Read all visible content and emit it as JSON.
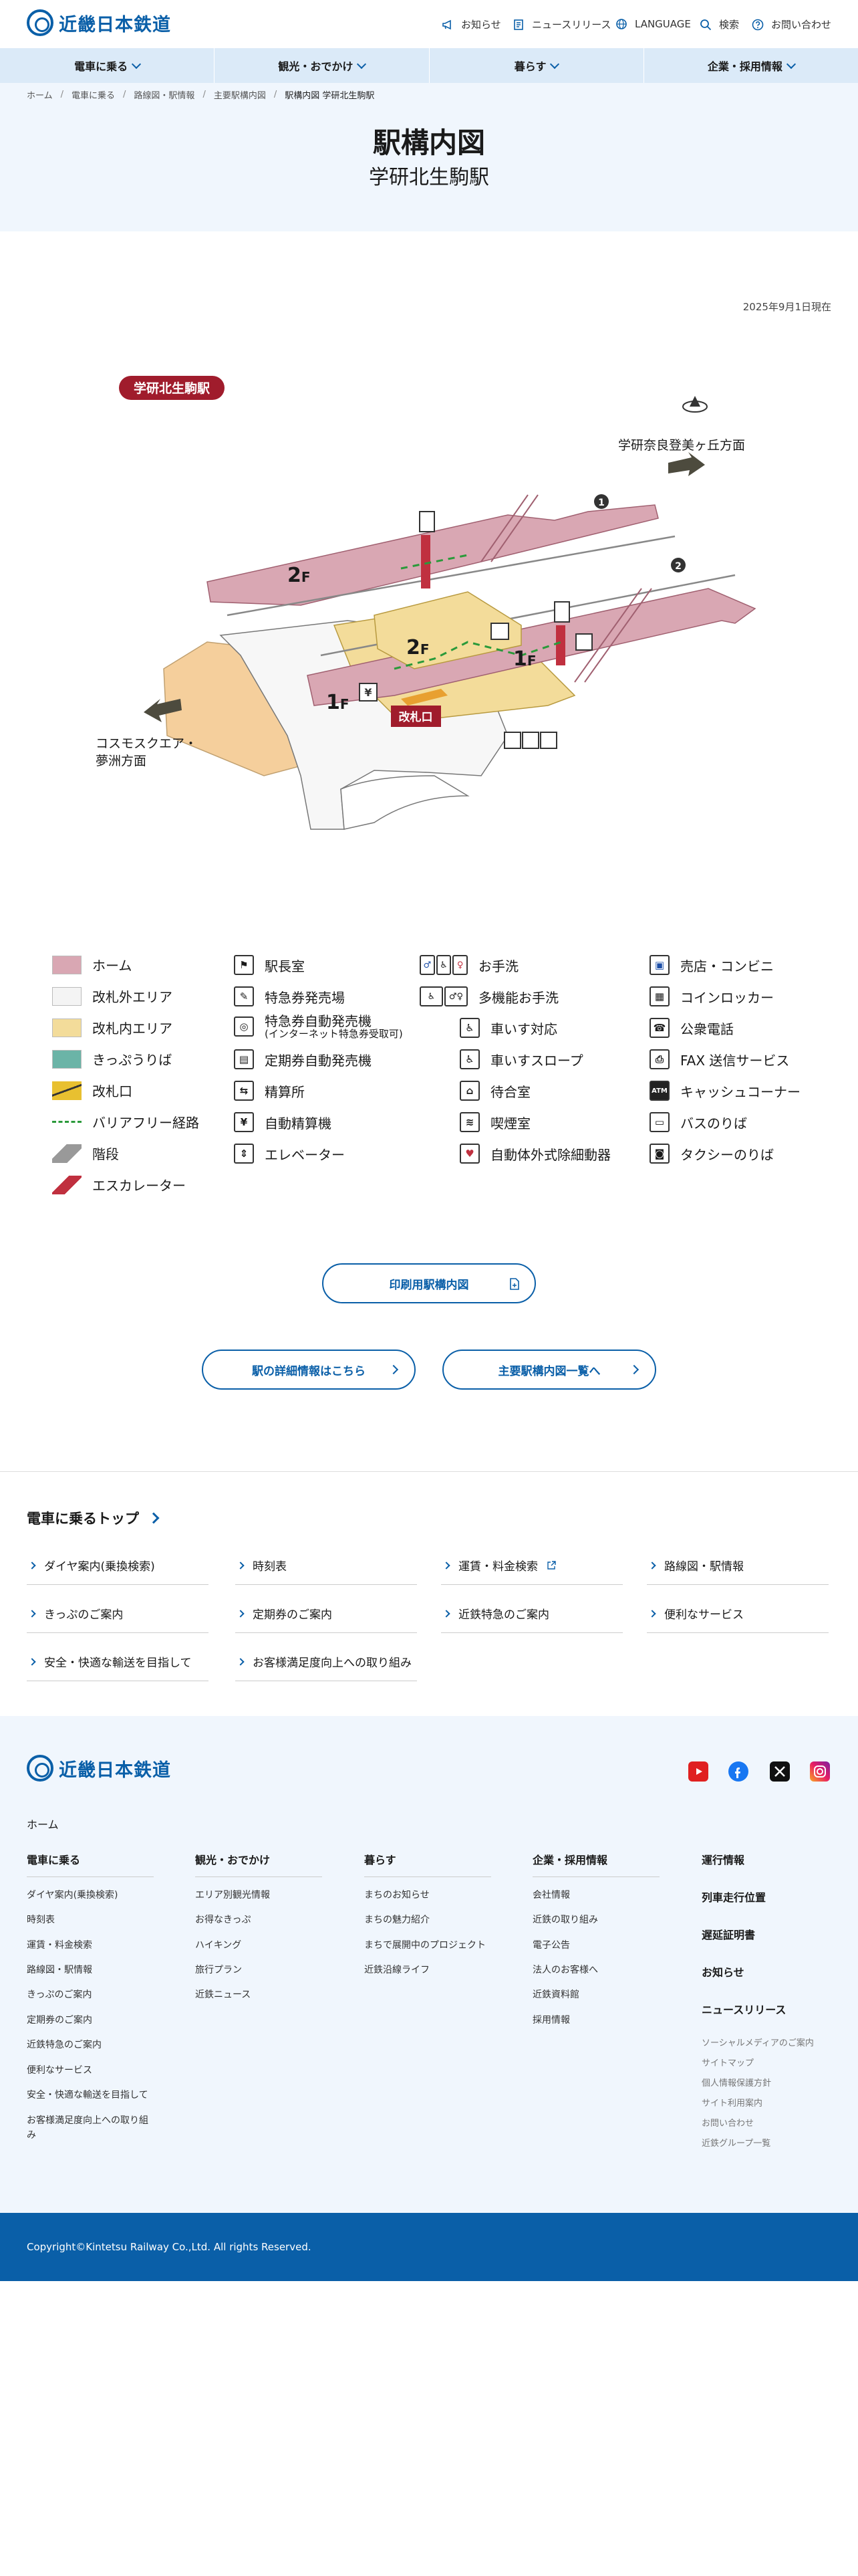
{
  "header": {
    "logo_text": "近畿日本鉄道",
    "utility": [
      {
        "label": "お知らせ",
        "icon": "megaphone-icon"
      },
      {
        "label": "ニュースリリース",
        "icon": "document-icon"
      },
      {
        "label": "LANGUAGE",
        "icon": "globe-icon"
      },
      {
        "label": "検索",
        "icon": "search-icon"
      },
      {
        "label": "お問い合わせ",
        "icon": "question-icon"
      }
    ]
  },
  "nav": [
    {
      "label": "電車に乗る"
    },
    {
      "label": "観光・おでかけ"
    },
    {
      "label": "暮らす"
    },
    {
      "label": "企業・採用情報"
    }
  ],
  "breadcrumb": [
    "ホーム",
    "電車に乗る",
    "路線図・駅情報",
    "主要駅構内図",
    "駅構内図 学研北生駒駅"
  ],
  "page": {
    "title": "駅構内図",
    "station": "学研北生駒駅",
    "as_of": "2025年9月1日現在"
  },
  "map": {
    "station_badge": "学研北生駒駅",
    "dir_right": "学研奈良登美ヶ丘方面",
    "dir_left_1": "コスモスクエア・",
    "dir_left_2": "夢洲方面",
    "floor_2f_a": "2",
    "floor_2f_b": "2",
    "floor_1f_a": "1",
    "floor_1f_b": "1",
    "floor_suffix": "F",
    "gate_label": "改札口",
    "track_1": "1",
    "track_2": "2"
  },
  "legend": {
    "col1": [
      {
        "label": "ホーム",
        "color": "#d9a7b3"
      },
      {
        "label": "改札外エリア",
        "color": "#f4f4f4"
      },
      {
        "label": "改札内エリア",
        "color": "#f3dc9a"
      },
      {
        "label": "きっぷうりば",
        "color": "#6bb4a7"
      },
      {
        "label": "改札口"
      },
      {
        "label": "バリアフリー経路"
      },
      {
        "label": "階段"
      },
      {
        "label": "エスカレーター"
      }
    ],
    "col2": [
      {
        "label": "駅長室",
        "icon": "flag-icon"
      },
      {
        "label": "特急券発売場",
        "icon": "ticket-icon"
      },
      {
        "label": "特急券自動発売機",
        "sub": "(インターネット特急券受取可)",
        "icon": "express-ticket-machine-icon"
      },
      {
        "label": "定期券自動発売機",
        "icon": "pass-machine-icon"
      },
      {
        "label": "精算所",
        "icon": "fare-adjust-icon"
      },
      {
        "label": "自動精算機",
        "icon": "yen-icon",
        "glyph": "¥"
      },
      {
        "label": "エレベーター",
        "icon": "elevator-icon"
      }
    ],
    "col3": [
      {
        "label": "お手洗",
        "icon": "restroom-icon"
      },
      {
        "label": "多機能お手洗",
        "icon": "accessible-restroom-icon"
      },
      {
        "label": "車いす対応",
        "icon": "wheelchair-icon"
      },
      {
        "label": "車いすスロープ",
        "icon": "wheelchair-slope-icon"
      },
      {
        "label": "待合室",
        "icon": "waiting-room-icon"
      },
      {
        "label": "喫煙室",
        "icon": "smoking-icon"
      },
      {
        "label": "自動体外式除細動器",
        "icon": "aed-icon"
      }
    ],
    "col4": [
      {
        "label": "売店・コンビニ",
        "icon": "shop-icon"
      },
      {
        "label": "コインロッカー",
        "icon": "locker-icon"
      },
      {
        "label": "公衆電話",
        "icon": "phone-icon"
      },
      {
        "label": "FAX 送信サービス",
        "icon": "fax-icon"
      },
      {
        "label": "キャッシュコーナー",
        "icon": "atm-icon",
        "glyph": "ATM"
      },
      {
        "label": "バスのりば",
        "icon": "bus-icon"
      },
      {
        "label": "タクシーのりば",
        "icon": "taxi-icon"
      }
    ]
  },
  "buttons": {
    "print": "印刷用駅構内図",
    "detail": "駅の詳細情報はこちら",
    "list": "主要駅構内図一覧へ"
  },
  "train_top": {
    "title": "電車に乗るトップ",
    "links": [
      "ダイヤ案内(乗換検索)",
      "時刻表",
      "運賃・料金検索",
      "路線図・駅情報",
      "きっぷのご案内",
      "定期券のご案内",
      "近鉄特急のご案内",
      "便利なサービス",
      "安全・快適な輸送を目指して",
      "お客様満足度向上への取り組み"
    ]
  },
  "footer": {
    "logo_text": "近畿日本鉄道",
    "home": "ホーム",
    "col1": {
      "title": "電車に乗る",
      "links": [
        "ダイヤ案内(乗換検索)",
        "時刻表",
        "運賃・料金検索",
        "路線図・駅情報",
        "きっぷのご案内",
        "定期券のご案内",
        "近鉄特急のご案内",
        "便利なサービス",
        "安全・快適な輸送を目指して",
        "お客様満足度向上への取り組",
        "み"
      ]
    },
    "col2": {
      "title": "観光・おでかけ",
      "links": [
        "エリア別観光情報",
        "お得なきっぷ",
        "ハイキング",
        "旅行プラン",
        "近鉄ニュース"
      ]
    },
    "col3": {
      "title": "暮らす",
      "links": [
        "まちのお知らせ",
        "まちの魅力紹介",
        "まちで展開中のプロジェクト",
        "近鉄沿線ライフ"
      ]
    },
    "col4": {
      "title": "企業・採用情報",
      "links": [
        "会社情報",
        "近鉄の取り組み",
        "電子公告",
        "法人のお客様へ",
        "近鉄資料館",
        "採用情報"
      ]
    },
    "col5": [
      "運行情報",
      "列車走行位置",
      "遅延証明書",
      "お知らせ",
      "ニュースリリース"
    ],
    "small_links": [
      "ソーシャルメディアのご案内",
      "サイトマップ",
      "個人情報保護方針",
      "サイト利用案内",
      "お問い合わせ",
      "近鉄グループ一覧"
    ],
    "copyright": "Copyright©Kintetsu Railway Co.,Ltd. All rights Reserved."
  },
  "colors": {
    "brand": "#0a5fa8",
    "nav_bg": "#dbeaf8",
    "hero_bg": "#f0f6fd",
    "badge": "#a01c2c"
  }
}
